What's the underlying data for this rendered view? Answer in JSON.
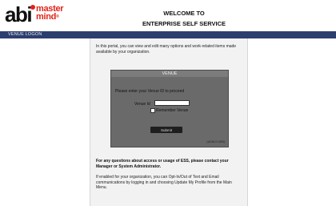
{
  "brand": {
    "logo_abi": "abi",
    "logo_line1": "master",
    "logo_line2": "mind",
    "logo_reg": "®",
    "accent": "#e2231a"
  },
  "header": {
    "line1": "WELCOME TO",
    "line2": "ENTERPRISE SELF SERVICE"
  },
  "nav": {
    "label": "VENUE LOGON",
    "color": "#2c3e6e"
  },
  "main": {
    "intro": "In this portal, you can view and edit many options and work-related items made available by your organization.",
    "venue_panel": {
      "title": "VENUE",
      "prompt": "Please enter your Venue ID to proceed",
      "venue_id_label": "Venue Id",
      "venue_id_value": "",
      "remember_label": "Remember Venue",
      "remember_checked": false,
      "submit_label": "Submit",
      "version": "(v8.55.2.1000)"
    },
    "questions": "For any questions about access or usage of ESS, please contact your Manager or System Administrator.",
    "optin": "If enabled for your organization, you can Opt-In/Out of Text and Email communications by logging in and choosing Update My Profile from the Main Menu."
  }
}
